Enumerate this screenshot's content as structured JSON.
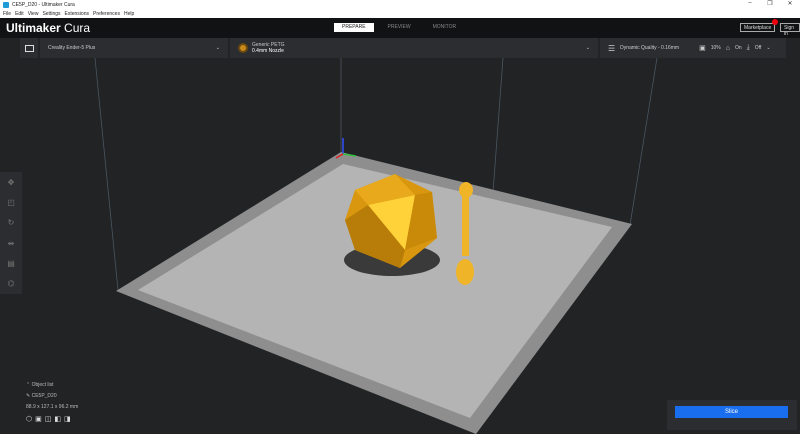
{
  "window": {
    "title": "CE5P_D20 - Ultimaker Cura",
    "minimize": "–",
    "restore": "❐",
    "close": "✕"
  },
  "menu": [
    "File",
    "Edit",
    "View",
    "Settings",
    "Extensions",
    "Preferences",
    "Help"
  ],
  "header": {
    "brand_bold": "Ultimaker",
    "brand_light": " Cura",
    "tabs": [
      "PREPARE",
      "PREVIEW",
      "MONITOR"
    ],
    "marketplace": "Marketplace",
    "signin": "Sign in"
  },
  "toolbar": {
    "printer": "Creality Ender-5 Plus",
    "material": "Generic PETG",
    "nozzle": "0.4mm Nozzle",
    "profile": "Dynamic Quality - 0.16mm",
    "infill": "10%",
    "support": "On",
    "adhesion": "Off"
  },
  "objects": {
    "header": "Object list",
    "name": "CE5P_D20",
    "dims": "88.9 x 127.1 x 96.2 mm"
  },
  "slice": {
    "label": "Slice"
  },
  "colors": {
    "accent": "#196ef0",
    "model": "#f0b429"
  }
}
